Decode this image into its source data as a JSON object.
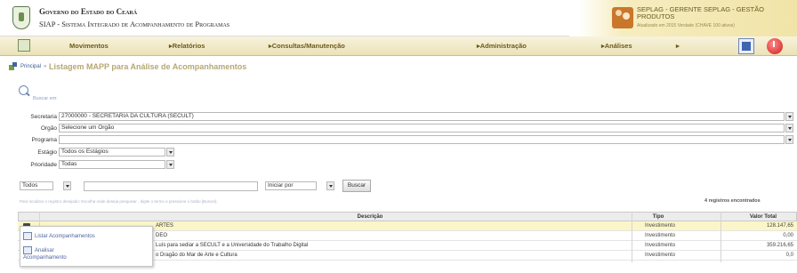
{
  "header": {
    "gov_title": "Governo do Estado do Ceará",
    "system_title": "SIAP - Sistema Integrado de Acompanhamento de Programas",
    "user_line1": "SEPLAG - GERENTE SEPLAG - GESTÃO",
    "user_line2": "PRODUTOS",
    "user_line3": "Atualizado em 2015 Verdade (CHAVE 100 ativos)"
  },
  "menu": {
    "items": [
      "Movimentos",
      "Relatórios",
      "Consultas/Manutenção",
      "Administração",
      "Análises"
    ]
  },
  "breadcrumb": {
    "link": "Principal",
    "separator": "»",
    "title": "Listagem MAPP para Análise de Acompanhamentos"
  },
  "search": {
    "label": "Buscar em:"
  },
  "form": {
    "secretaria_label": "Secretaria",
    "secretaria_value": "27000000 - SECRETARIA DA CULTURA (SECULT)",
    "orgao_label": "Orgão",
    "orgao_value": "Selecione um Orgão",
    "programa_label": "Programa",
    "programa_value": "",
    "estagio_label": "Estágio",
    "estagio_value": "Todos os Estágios",
    "prioridade_label": "Prioridade",
    "prioridade_value": "Todas"
  },
  "filter": {
    "field_value": "Todos",
    "mode_value": "Iniciar por",
    "search_button": "Buscar",
    "hint": "Para localizar o registro desejado: Escolha onde deseja pesquisar , digite o termo e pressione o botão [Buscar].",
    "records": "4 registros encontrados"
  },
  "table": {
    "headers": [
      "Descrição",
      "Tipo",
      "Valor Total"
    ],
    "rows": [
      {
        "desc": "ARTES",
        "tipo": "Investimento",
        "valor": "128.147,65"
      },
      {
        "desc": "DEO",
        "tipo": "Investimento",
        "valor": "0,00"
      },
      {
        "desc": "Luís  para sediar a SECULT e a Universidade do Trabalho Digital",
        "tipo": "Investimento",
        "valor": "359.216,65"
      },
      {
        "desc": "o Dragão do Mar de Arte e Cultura",
        "tipo": "Investimento",
        "valor": "0,0"
      }
    ]
  },
  "context_menu": {
    "item1": "Listar Acompanhamentos",
    "item2_line1": "Analisar",
    "item2_line2": "Acompanhamento"
  }
}
